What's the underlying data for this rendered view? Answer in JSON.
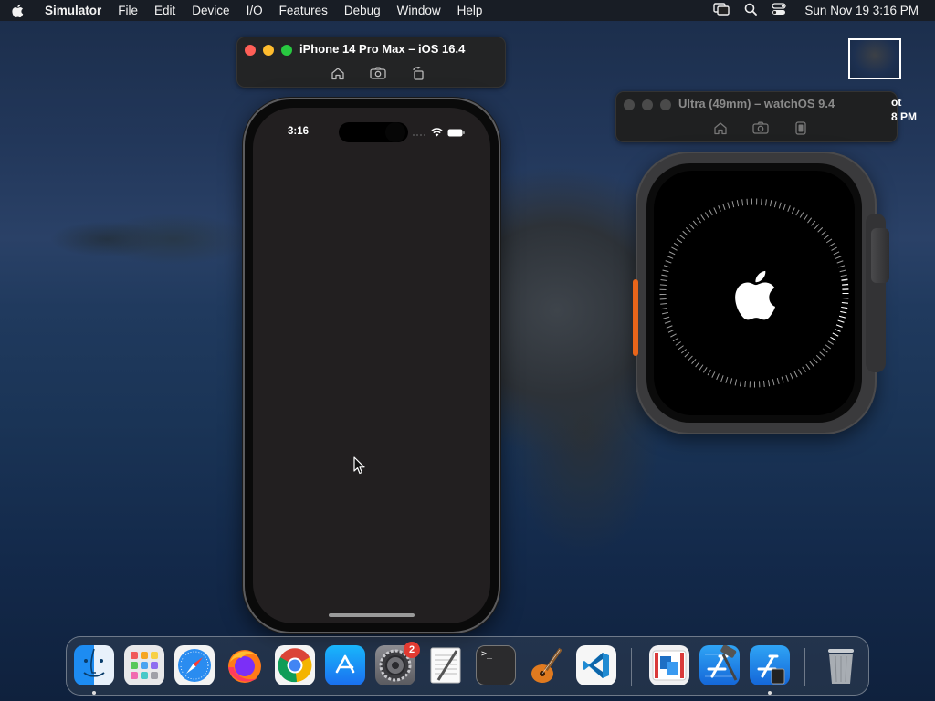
{
  "menubar": {
    "app_name": "Simulator",
    "items": [
      "File",
      "Edit",
      "Device",
      "I/O",
      "Features",
      "Debug",
      "Window",
      "Help"
    ],
    "clock": "Sun Nov 19  3:16 PM",
    "status_icons": [
      "screen-mirroring-icon",
      "spotlight-search-icon",
      "control-center-icon"
    ]
  },
  "iphone_window": {
    "title": "iPhone 14 Pro Max – iOS 16.4",
    "tools": [
      "home-icon",
      "screenshot-icon",
      "rotate-icon"
    ],
    "status_time": "3:16"
  },
  "watch_window": {
    "title": "Ultra (49mm) – watchOS 9.4",
    "tools": [
      "home-icon",
      "screenshot-icon",
      "side-button-icon"
    ]
  },
  "screenshot_preview": {
    "label_line1": "ot",
    "label_line2": "8 PM"
  },
  "dock": {
    "apps": [
      {
        "name": "Finder",
        "icon": "finder-icon",
        "running": true
      },
      {
        "name": "Launchpad",
        "icon": "launchpad-icon",
        "running": false
      },
      {
        "name": "Safari",
        "icon": "safari-icon",
        "running": false
      },
      {
        "name": "Firefox",
        "icon": "firefox-icon",
        "running": false
      },
      {
        "name": "Google Chrome",
        "icon": "chrome-icon",
        "running": false
      },
      {
        "name": "App Store",
        "icon": "app-store-icon",
        "running": false
      },
      {
        "name": "System Settings",
        "icon": "system-settings-icon",
        "running": false
      },
      {
        "name": "TextEdit",
        "icon": "textedit-icon",
        "running": false
      },
      {
        "name": "Terminal",
        "icon": "terminal-icon",
        "running": false
      },
      {
        "name": "GarageBand",
        "icon": "garageband-icon",
        "running": false
      },
      {
        "name": "Visual Studio Code",
        "icon": "vscode-icon",
        "running": false
      },
      {
        "name": "Screen Sharing",
        "icon": "screen-sharing-icon",
        "running": false
      },
      {
        "name": "Xcode",
        "icon": "xcode-icon",
        "running": false
      },
      {
        "name": "Simulator",
        "icon": "simulator-icon",
        "running": true
      },
      {
        "name": "Trash",
        "icon": "trash-icon",
        "running": false
      }
    ],
    "settings_badge": "2",
    "terminal_prompt": ">_"
  },
  "colors": {
    "close": "#ff5f57",
    "minimize": "#febc2e",
    "zoom": "#28c840",
    "inactive_dot": "#4a4a4a",
    "watch_action_button": "#e8651a",
    "badge": "#e23b32"
  }
}
